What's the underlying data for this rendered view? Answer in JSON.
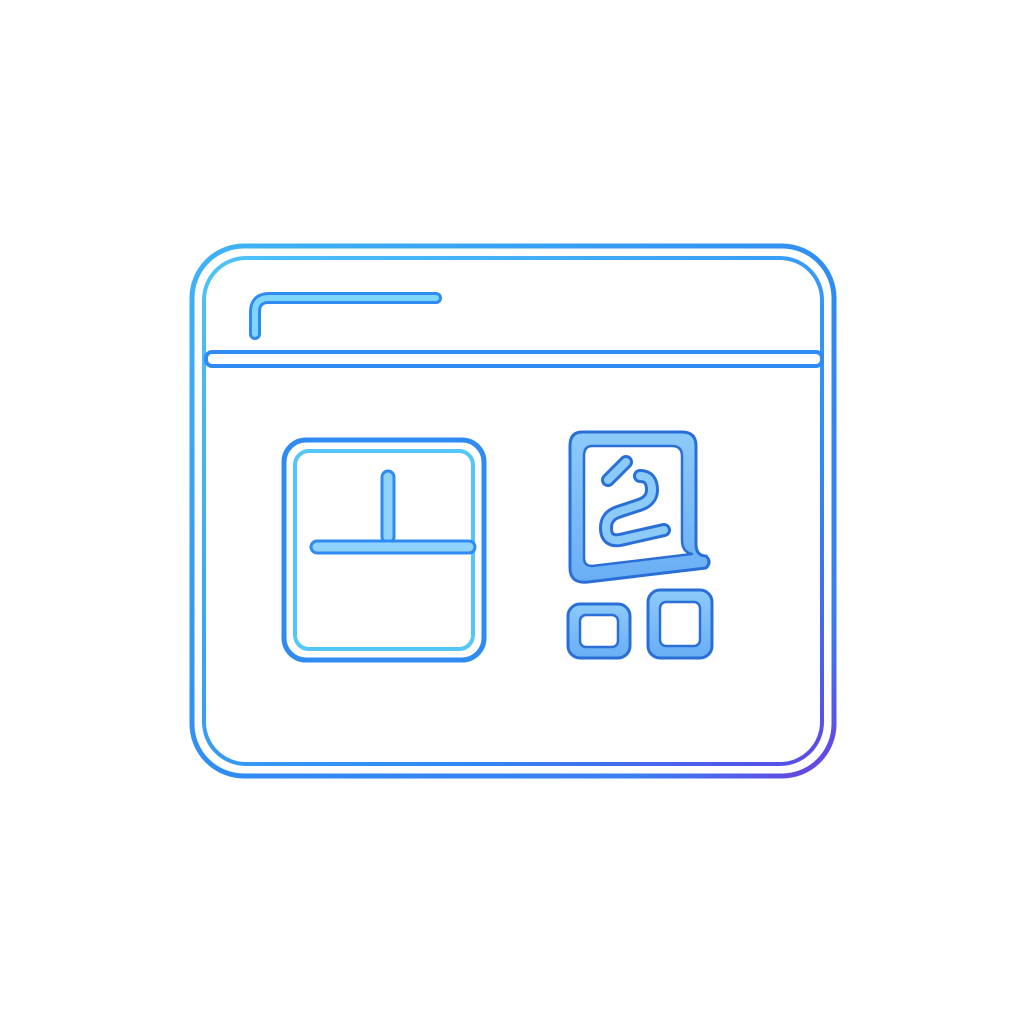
{
  "illustration": {
    "subject": "browser-window-outline-icon",
    "style": "neon line art, blue-to-violet gradient",
    "colors": {
      "stroke_primary": "#2f8bf2",
      "stroke_light": "#54c6f7",
      "stroke_violet": "#6a3fe0",
      "fill_glyph": "#79b9f6",
      "fill_panel": "#ffffff",
      "background": "#ffffff"
    },
    "icons": [
      "browser-window-icon",
      "title-bar-bracket-icon",
      "layout-panel-icon",
      "abstract-glyph-icon",
      "small-square-icon"
    ]
  }
}
